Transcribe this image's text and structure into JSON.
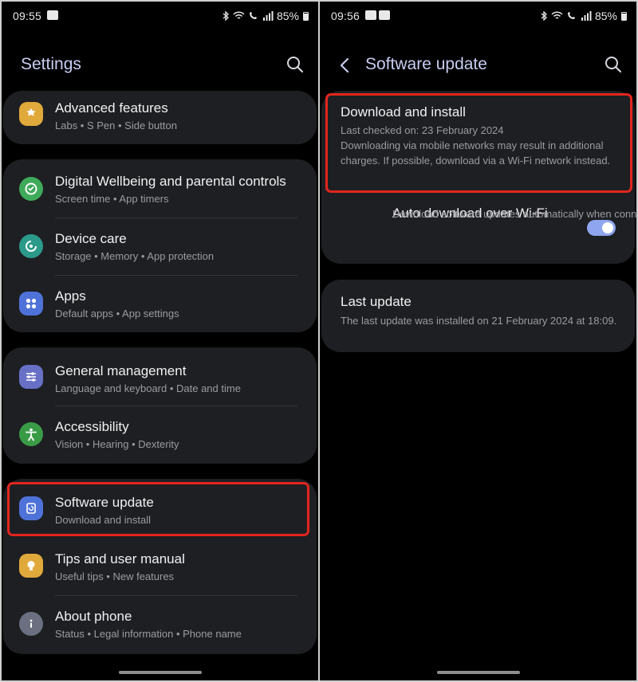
{
  "left": {
    "status": {
      "time": "09:55",
      "battery": "85%"
    },
    "title": "Settings",
    "groups": [
      [
        {
          "label": "Advanced features",
          "sub": "Labs  •  S Pen  •  Side button",
          "icon": "star-gear-icon",
          "color": "#e0a93c"
        }
      ],
      [
        {
          "label": "Digital Wellbeing and parental controls",
          "sub": "Screen time  •  App timers",
          "icon": "wellbeing-icon",
          "color": "#3faa5a"
        },
        {
          "label": "Device care",
          "sub": "Storage  •  Memory  •  App protection",
          "icon": "device-care-icon",
          "color": "#2c9a8a"
        },
        {
          "label": "Apps",
          "sub": "Default apps  •  App settings",
          "icon": "apps-grid-icon",
          "color": "#4f72d9"
        }
      ],
      [
        {
          "label": "General management",
          "sub": "Language and keyboard  •  Date and time",
          "icon": "sliders-icon",
          "color": "#6870c6"
        },
        {
          "label": "Accessibility",
          "sub": "Vision  •  Hearing  •  Dexterity",
          "icon": "accessibility-icon",
          "color": "#3a9b47"
        }
      ],
      [
        {
          "label": "Software update",
          "sub": "Download and install",
          "icon": "software-update-icon",
          "color": "#4f72d9"
        },
        {
          "label": "Tips and user manual",
          "sub": "Useful tips  •  New features",
          "icon": "lightbulb-icon",
          "color": "#e0a93c"
        },
        {
          "label": "About phone",
          "sub": "Status  •  Legal information  •  Phone name",
          "icon": "info-icon",
          "color": "#6b6f80"
        }
      ]
    ]
  },
  "right": {
    "status": {
      "time": "09:56",
      "battery": "85%"
    },
    "title": "Software update",
    "download": {
      "label": "Download and install",
      "checked": "Last checked on: 23 February 2024",
      "note": "Downloading via mobile networks may result in additional charges. If possible, download via a Wi-Fi network instead."
    },
    "auto": {
      "label": "Auto download over Wi-Fi",
      "sub": "Download software updates automatically when connected to a Wi-Fi network.",
      "enabled": true
    },
    "last": {
      "label": "Last update",
      "sub": "The last update was installed on 21 February 2024 at 18:09."
    }
  },
  "colors": {
    "accent": "#8fa5ef",
    "title": "#c7cdf2",
    "highlight": "#e2261d",
    "card": "#1e1f23"
  }
}
